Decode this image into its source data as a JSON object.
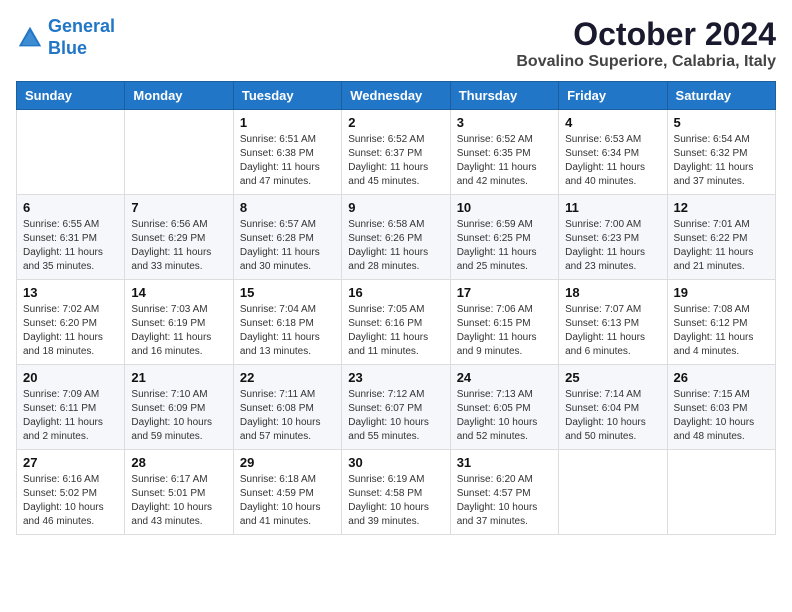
{
  "header": {
    "logo_line1": "General",
    "logo_line2": "Blue",
    "month": "October 2024",
    "location": "Bovalino Superiore, Calabria, Italy"
  },
  "weekdays": [
    "Sunday",
    "Monday",
    "Tuesday",
    "Wednesday",
    "Thursday",
    "Friday",
    "Saturday"
  ],
  "weeks": [
    [
      {
        "day": "",
        "info": ""
      },
      {
        "day": "",
        "info": ""
      },
      {
        "day": "1",
        "info": "Sunrise: 6:51 AM\nSunset: 6:38 PM\nDaylight: 11 hours and 47 minutes."
      },
      {
        "day": "2",
        "info": "Sunrise: 6:52 AM\nSunset: 6:37 PM\nDaylight: 11 hours and 45 minutes."
      },
      {
        "day": "3",
        "info": "Sunrise: 6:52 AM\nSunset: 6:35 PM\nDaylight: 11 hours and 42 minutes."
      },
      {
        "day": "4",
        "info": "Sunrise: 6:53 AM\nSunset: 6:34 PM\nDaylight: 11 hours and 40 minutes."
      },
      {
        "day": "5",
        "info": "Sunrise: 6:54 AM\nSunset: 6:32 PM\nDaylight: 11 hours and 37 minutes."
      }
    ],
    [
      {
        "day": "6",
        "info": "Sunrise: 6:55 AM\nSunset: 6:31 PM\nDaylight: 11 hours and 35 minutes."
      },
      {
        "day": "7",
        "info": "Sunrise: 6:56 AM\nSunset: 6:29 PM\nDaylight: 11 hours and 33 minutes."
      },
      {
        "day": "8",
        "info": "Sunrise: 6:57 AM\nSunset: 6:28 PM\nDaylight: 11 hours and 30 minutes."
      },
      {
        "day": "9",
        "info": "Sunrise: 6:58 AM\nSunset: 6:26 PM\nDaylight: 11 hours and 28 minutes."
      },
      {
        "day": "10",
        "info": "Sunrise: 6:59 AM\nSunset: 6:25 PM\nDaylight: 11 hours and 25 minutes."
      },
      {
        "day": "11",
        "info": "Sunrise: 7:00 AM\nSunset: 6:23 PM\nDaylight: 11 hours and 23 minutes."
      },
      {
        "day": "12",
        "info": "Sunrise: 7:01 AM\nSunset: 6:22 PM\nDaylight: 11 hours and 21 minutes."
      }
    ],
    [
      {
        "day": "13",
        "info": "Sunrise: 7:02 AM\nSunset: 6:20 PM\nDaylight: 11 hours and 18 minutes."
      },
      {
        "day": "14",
        "info": "Sunrise: 7:03 AM\nSunset: 6:19 PM\nDaylight: 11 hours and 16 minutes."
      },
      {
        "day": "15",
        "info": "Sunrise: 7:04 AM\nSunset: 6:18 PM\nDaylight: 11 hours and 13 minutes."
      },
      {
        "day": "16",
        "info": "Sunrise: 7:05 AM\nSunset: 6:16 PM\nDaylight: 11 hours and 11 minutes."
      },
      {
        "day": "17",
        "info": "Sunrise: 7:06 AM\nSunset: 6:15 PM\nDaylight: 11 hours and 9 minutes."
      },
      {
        "day": "18",
        "info": "Sunrise: 7:07 AM\nSunset: 6:13 PM\nDaylight: 11 hours and 6 minutes."
      },
      {
        "day": "19",
        "info": "Sunrise: 7:08 AM\nSunset: 6:12 PM\nDaylight: 11 hours and 4 minutes."
      }
    ],
    [
      {
        "day": "20",
        "info": "Sunrise: 7:09 AM\nSunset: 6:11 PM\nDaylight: 11 hours and 2 minutes."
      },
      {
        "day": "21",
        "info": "Sunrise: 7:10 AM\nSunset: 6:09 PM\nDaylight: 10 hours and 59 minutes."
      },
      {
        "day": "22",
        "info": "Sunrise: 7:11 AM\nSunset: 6:08 PM\nDaylight: 10 hours and 57 minutes."
      },
      {
        "day": "23",
        "info": "Sunrise: 7:12 AM\nSunset: 6:07 PM\nDaylight: 10 hours and 55 minutes."
      },
      {
        "day": "24",
        "info": "Sunrise: 7:13 AM\nSunset: 6:05 PM\nDaylight: 10 hours and 52 minutes."
      },
      {
        "day": "25",
        "info": "Sunrise: 7:14 AM\nSunset: 6:04 PM\nDaylight: 10 hours and 50 minutes."
      },
      {
        "day": "26",
        "info": "Sunrise: 7:15 AM\nSunset: 6:03 PM\nDaylight: 10 hours and 48 minutes."
      }
    ],
    [
      {
        "day": "27",
        "info": "Sunrise: 6:16 AM\nSunset: 5:02 PM\nDaylight: 10 hours and 46 minutes."
      },
      {
        "day": "28",
        "info": "Sunrise: 6:17 AM\nSunset: 5:01 PM\nDaylight: 10 hours and 43 minutes."
      },
      {
        "day": "29",
        "info": "Sunrise: 6:18 AM\nSunset: 4:59 PM\nDaylight: 10 hours and 41 minutes."
      },
      {
        "day": "30",
        "info": "Sunrise: 6:19 AM\nSunset: 4:58 PM\nDaylight: 10 hours and 39 minutes."
      },
      {
        "day": "31",
        "info": "Sunrise: 6:20 AM\nSunset: 4:57 PM\nDaylight: 10 hours and 37 minutes."
      },
      {
        "day": "",
        "info": ""
      },
      {
        "day": "",
        "info": ""
      }
    ]
  ]
}
